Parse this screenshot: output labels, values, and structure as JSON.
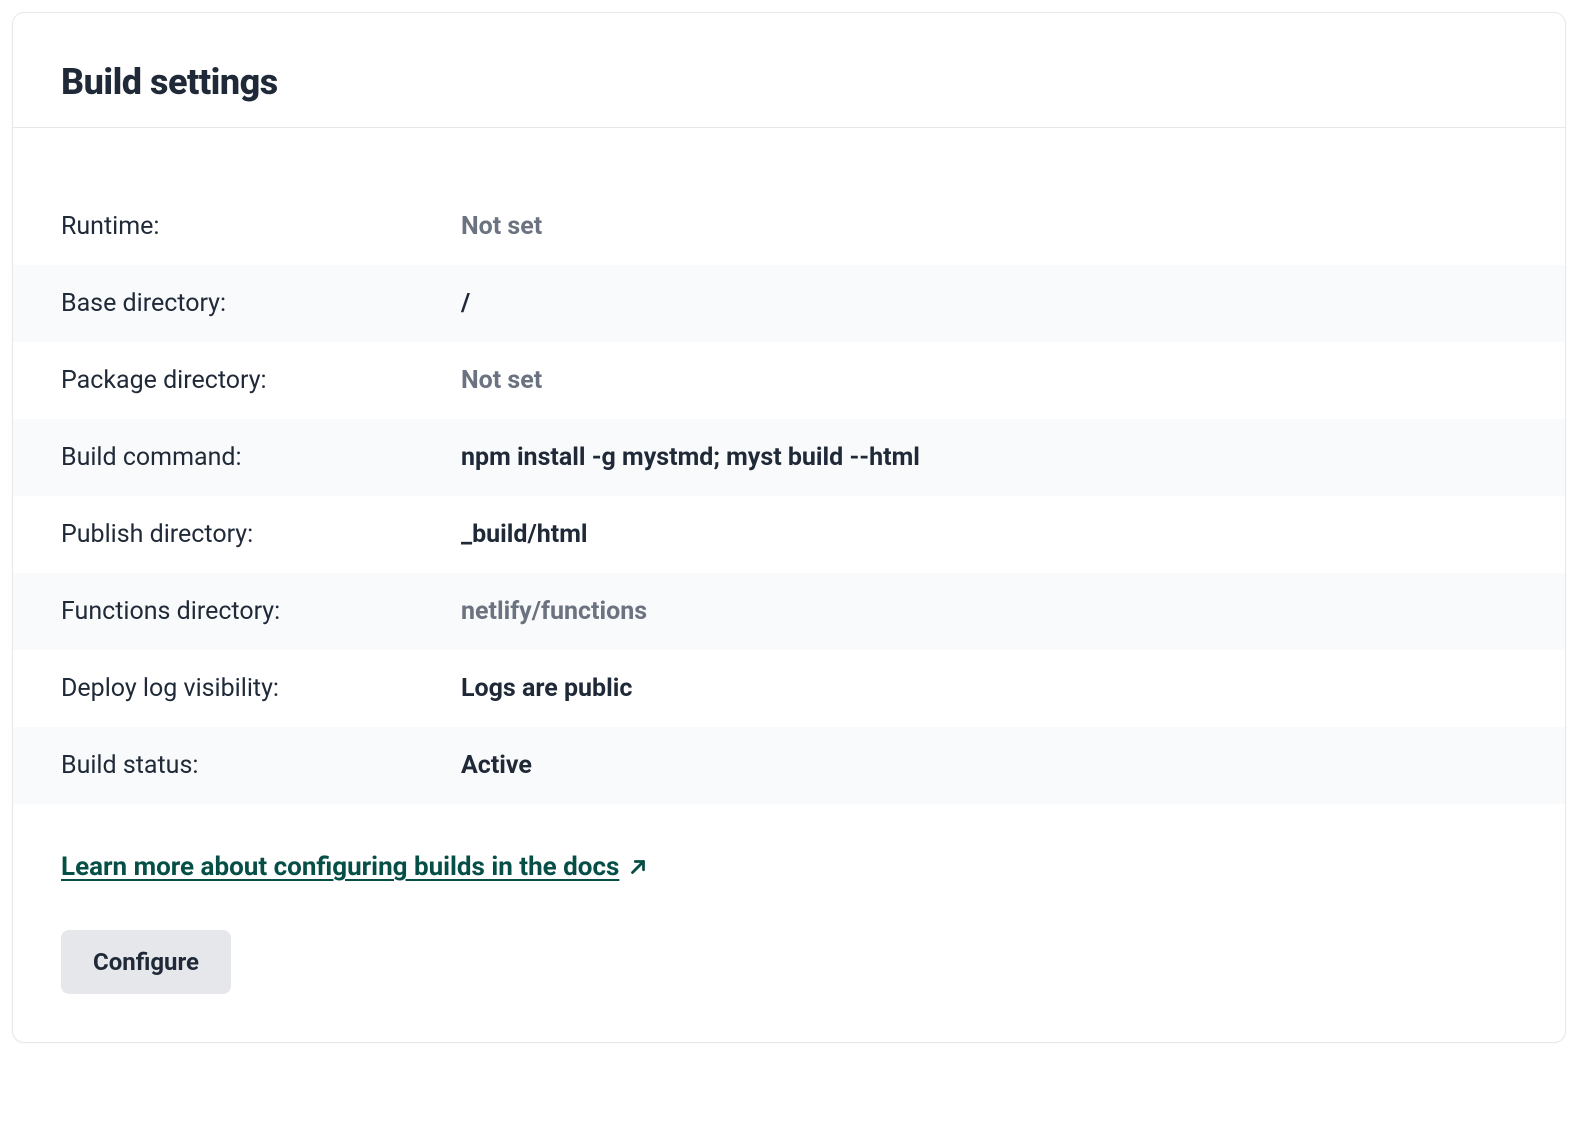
{
  "card": {
    "title": "Build settings"
  },
  "settings": [
    {
      "label": "Runtime:",
      "value": "Not set",
      "muted": true
    },
    {
      "label": "Base directory:",
      "value": "/",
      "muted": false
    },
    {
      "label": "Package directory:",
      "value": "Not set",
      "muted": true
    },
    {
      "label": "Build command:",
      "value": "npm install -g mystmd; myst build --html",
      "muted": false
    },
    {
      "label": "Publish directory:",
      "value": "_build/html",
      "muted": false
    },
    {
      "label": "Functions directory:",
      "value": "netlify/functions",
      "muted": true
    },
    {
      "label": "Deploy log visibility:",
      "value": "Logs are public",
      "muted": false
    },
    {
      "label": "Build status:",
      "value": "Active",
      "muted": false
    }
  ],
  "docs_link": {
    "text": "Learn more about configuring builds in the docs"
  },
  "actions": {
    "configure_label": "Configure"
  }
}
